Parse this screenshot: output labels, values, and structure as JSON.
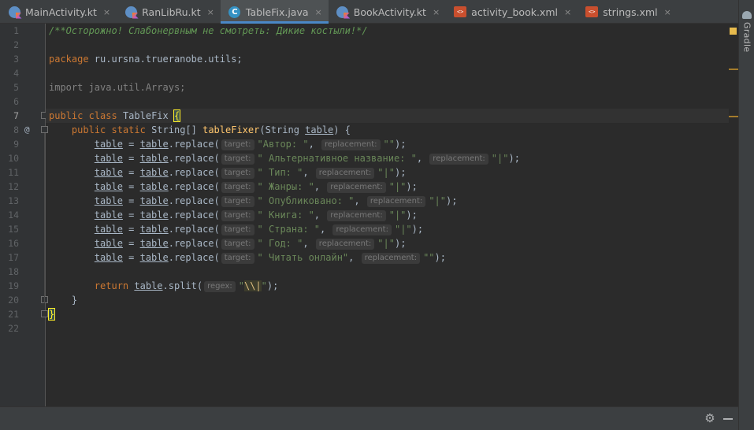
{
  "tabs": [
    {
      "label": "MainActivity.kt",
      "icon": "kotlin-file-icon",
      "active": false
    },
    {
      "label": "RanLibRu.kt",
      "icon": "kotlin-file-icon",
      "active": false
    },
    {
      "label": "TableFix.java",
      "icon": "java-class-icon",
      "active": true
    },
    {
      "label": "BookActivity.kt",
      "icon": "kotlin-file-icon",
      "active": false
    },
    {
      "label": "activity_book.xml",
      "icon": "xml-file-icon",
      "active": false
    },
    {
      "label": "strings.xml",
      "icon": "xml-file-icon",
      "active": false
    }
  ],
  "tab_close_glyph": "×",
  "java_icon_letter": "C",
  "xml_icon_text": "<>",
  "right_panel": {
    "label": "Gradle"
  },
  "gutter": {
    "line_numbers": [
      "1",
      "2",
      "3",
      "4",
      "5",
      "6",
      "7",
      "8",
      "9",
      "10",
      "11",
      "12",
      "13",
      "14",
      "15",
      "16",
      "17",
      "18",
      "19",
      "20",
      "21",
      "22"
    ],
    "override_marker": "@"
  },
  "code": {
    "comment": "/**Осторожно! Слабонервным не смотреть: Дикие костыли!*/",
    "package_kw": "package",
    "package_name": " ru.ursna.trueranobe.utils;",
    "import_kw": "import",
    "import_name": " java.util.Arrays;",
    "class_line": {
      "public": "public",
      "class": "class",
      "name": " TableFix ",
      "brace": "{"
    },
    "method_line": {
      "public": "public",
      "static": "static",
      "ret": " String[] ",
      "name": "tableFixer",
      "params_a": "(String ",
      "param": "table",
      "params_b": ") {"
    },
    "var": "table",
    "assign": " = ",
    "call": ".replace(",
    "hint_target": "target:",
    "hint_replacement": "replacement:",
    "replacements": [
      {
        "target": "\"Автор: \"",
        "replacement": "\"\""
      },
      {
        "target": "\" Альтернативное название: \"",
        "replacement": "\"|\""
      },
      {
        "target": "\" Тип: \"",
        "replacement": "\"|\""
      },
      {
        "target": "\" Жанры: \"",
        "replacement": "\"|\""
      },
      {
        "target": "\" Опубликовано: \"",
        "replacement": "\"|\""
      },
      {
        "target": "\" Книга: \"",
        "replacement": "\"|\""
      },
      {
        "target": "\" Страна: \"",
        "replacement": "\"|\""
      },
      {
        "target": "\" Год: \"",
        "replacement": "\"|\""
      },
      {
        "target": "\" Читать онлайн\"",
        "replacement": "\"\""
      }
    ],
    "comma": ", ",
    "close": ");",
    "return_kw": "return",
    "split_call": ".split(",
    "hint_regex": "regex:",
    "regex_quote": "\"",
    "regex_value": "\\\\|",
    "method_close": "}",
    "class_close": "}"
  },
  "bottom": {
    "settings_icon": "gear-icon",
    "hide_icon": "minus-icon"
  },
  "colors": {
    "keyword": "#cc7832",
    "string": "#6a8759",
    "comment": "#629755",
    "method": "#ffc66d",
    "text": "#a9b7c6",
    "accent": "#4a88c7"
  }
}
